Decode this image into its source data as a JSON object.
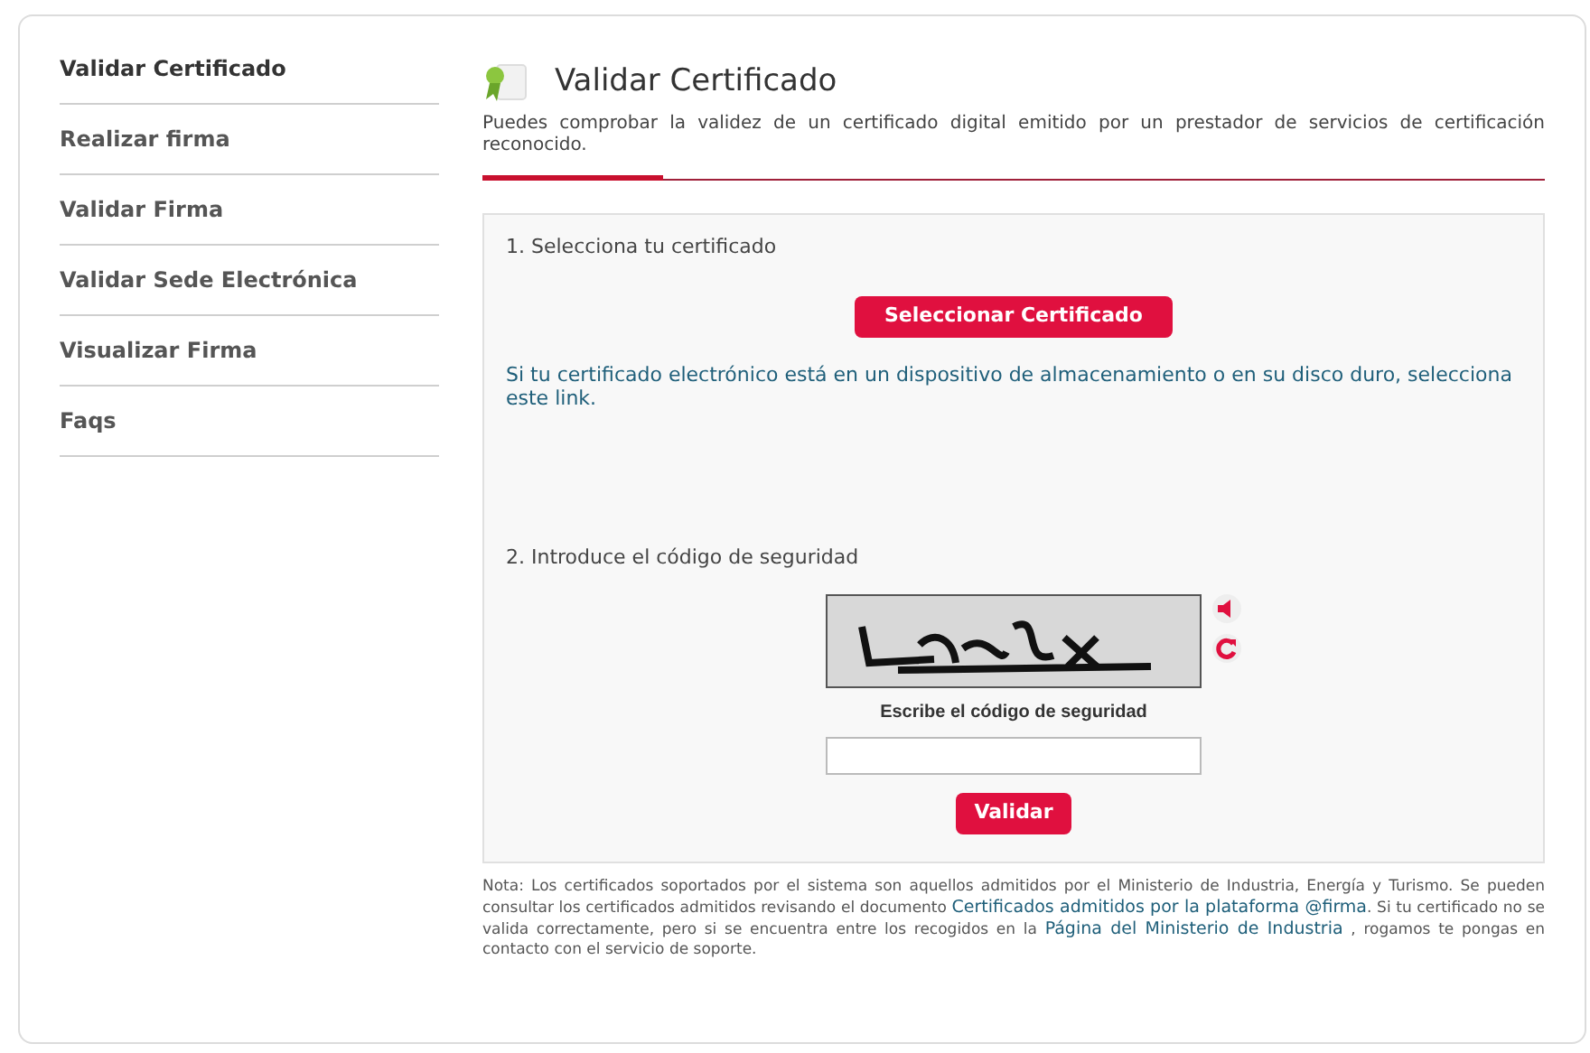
{
  "sidebar": {
    "items": [
      {
        "label": "Validar Certificado",
        "selected": true
      },
      {
        "label": "Realizar firma",
        "selected": false
      },
      {
        "label": "Validar Firma",
        "selected": false
      },
      {
        "label": "Validar Sede Electrónica",
        "selected": false
      },
      {
        "label": "Visualizar Firma",
        "selected": false
      },
      {
        "label": "Faqs",
        "selected": false
      }
    ]
  },
  "header": {
    "title": "Validar Certificado",
    "description": "Puedes comprobar la validez de un certificado digital emitido por un prestador de servicios de certificación reconocido."
  },
  "step1": {
    "heading": "1. Selecciona tu certificado",
    "button": "Seleccionar Certificado",
    "link": "Si tu certificado electrónico está en un dispositivo de almacenamiento o en su disco duro, selecciona este link."
  },
  "step2": {
    "heading": "2. Introduce el código de seguridad",
    "field_label": "Escribe el código de seguridad",
    "button": "Validar"
  },
  "note": [
    {
      "kind": "text",
      "text": "Nota: Los certificados soportados por el sistema son aquellos admitidos por el Ministerio de Industria, Energía y Turismo. Se pueden consultar los certificados admitidos revisando el documento "
    },
    {
      "kind": "link",
      "text": "Certificados admitidos por la plataforma @firma"
    },
    {
      "kind": "text",
      "text": ". Si tu certificado no se valida correctamente, pero si se encuentra entre los recogidos en la "
    },
    {
      "kind": "link",
      "text": "Página del Ministerio de Industria"
    },
    {
      "kind": "text",
      "text": " , rogamos te pongas en contacto con el servicio de soporte."
    }
  ]
}
